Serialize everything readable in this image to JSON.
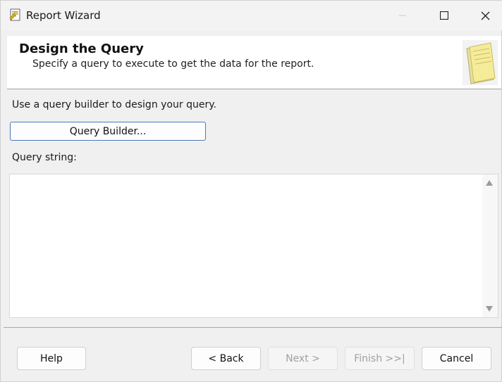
{
  "window": {
    "title": "Report Wizard",
    "icon": "report-wizard-icon"
  },
  "header": {
    "title": "Design the Query",
    "subtitle": "Specify a query to execute to get the data for the report.",
    "icon": "note-pages-icon"
  },
  "body": {
    "instruction": "Use a query builder to design your query.",
    "query_builder_label": "Query Builder...",
    "query_string_label": "Query string:",
    "query_string_value": ""
  },
  "footer": {
    "help_label": "Help",
    "back_label": "< Back",
    "next_label": "Next >",
    "finish_label": "Finish >>|",
    "cancel_label": "Cancel"
  }
}
